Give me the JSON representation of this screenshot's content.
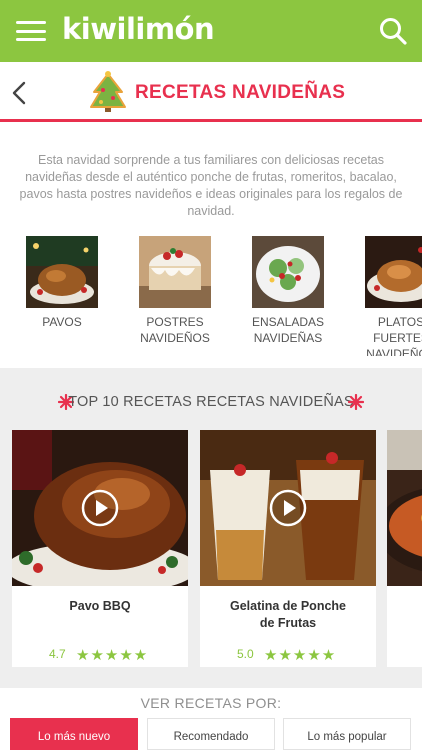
{
  "appbar": {
    "logo": "kiwilimón",
    "menu_icon": "hamburger-menu-icon",
    "search_icon": "search-icon",
    "color": "#8cc640"
  },
  "header": {
    "title": "RECETAS NAVIDEÑAS",
    "back_icon": "chevron-left-icon",
    "title_icon": "christmas-tree-icon",
    "accent": "#e8304e"
  },
  "description": "Esta navidad sorprende a tus familiares con deliciosas recetas navideñas desde el auténtico ponche de frutas, romeritos, bacalao, pavos hasta postres navideños e ideas originales para los regalos de navidad.",
  "categories": [
    {
      "label": "PAVOS"
    },
    {
      "label": "POSTRES\nNAVIDEÑOS"
    },
    {
      "label": "ENSALADAS\nNAVIDEÑAS"
    },
    {
      "label": "PLATOS FUERTES\nNAVIDEÑOS"
    }
  ],
  "top": {
    "title": "TOP 10 RECETAS RECETAS NAVIDEÑAS",
    "icon": "snowflake-icon",
    "recipes": [
      {
        "name": "Pavo BBQ",
        "rating": "4.7",
        "stars": 5,
        "has_video": true
      },
      {
        "name": "Gelatina de Ponche\nde Frutas",
        "rating": "5.0",
        "stars": 5,
        "has_video": true
      },
      {
        "name": "",
        "rating": "",
        "stars": 0,
        "has_video": false
      }
    ]
  },
  "sort": {
    "label": "VER RECETAS POR:",
    "options": [
      "Lo más nuevo",
      "Recomendado",
      "Lo más popular"
    ],
    "selected": "Lo más nuevo"
  }
}
